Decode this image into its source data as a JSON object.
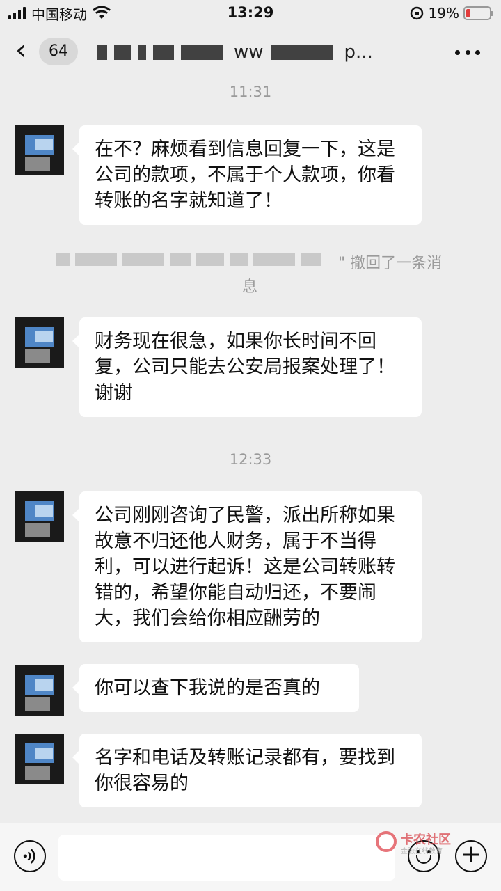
{
  "status_bar": {
    "carrier": "中国移动",
    "time": "13:29",
    "battery": "19%",
    "battery_level": 0.19
  },
  "nav": {
    "back_count": "64",
    "title_visible": "ww",
    "title_suffix": "p..."
  },
  "messages": [
    {
      "type": "timestamp",
      "text": "11:31"
    },
    {
      "type": "incoming",
      "text": "在不？麻烦看到信息回复一下，这是公司的款项，不属于个人款项，你看转账的名字就知道了！"
    },
    {
      "type": "recall",
      "text1": "\" 撤回了一条消",
      "text2": "息"
    },
    {
      "type": "incoming",
      "text": "财务现在很急，如果你长时间不回复，公司只能去公安局报案处理了！谢谢"
    },
    {
      "type": "timestamp",
      "text": "12:33"
    },
    {
      "type": "incoming",
      "text": "公司刚刚咨询了民警，派出所称如果故意不归还他人财务，属于不当得利，可以进行起诉！这是公司转账转错的，希望你能自动归还，不要闹大，我们会给你相应酬劳的"
    },
    {
      "type": "incoming",
      "text": "你可以查下我说的是否真的"
    },
    {
      "type": "incoming",
      "text": "名字和电话及转账记录都有，要找到你很容易的"
    }
  ],
  "watermark": {
    "title": "卡农社区",
    "subtitle": "金融在线教育"
  }
}
